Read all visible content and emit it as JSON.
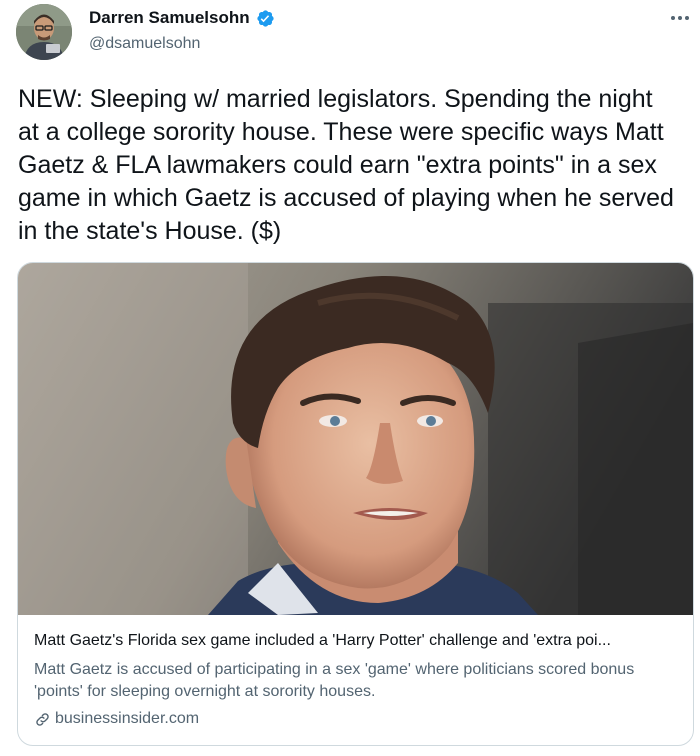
{
  "author": {
    "display_name": "Darren Samuelsohn",
    "handle": "@dsamuelsohn",
    "verified": true
  },
  "tweet": {
    "text": "NEW: Sleeping w/ married legislators. Spending the night at a college sorority house. These were specific ways Matt Gaetz & FLA lawmakers could earn \"extra points\" in a sex game in which Gaetz is accused of playing when he served in the state's House. ($)"
  },
  "link_card": {
    "title": "Matt Gaetz's Florida sex game included a 'Harry Potter' challenge and 'extra poi...",
    "description": "Matt Gaetz is accused of participating in a sex 'game' where politicians scored bonus 'points' for sleeping overnight at sorority houses.",
    "domain": "businessinsider.com"
  },
  "icons": {
    "verified": "verified-badge-icon",
    "more": "more-options-icon",
    "link": "link-icon"
  },
  "colors": {
    "verified_blue": "#1d9bf0",
    "text_primary": "#0f1419",
    "text_secondary": "#536471",
    "card_border": "#cfd9de"
  }
}
